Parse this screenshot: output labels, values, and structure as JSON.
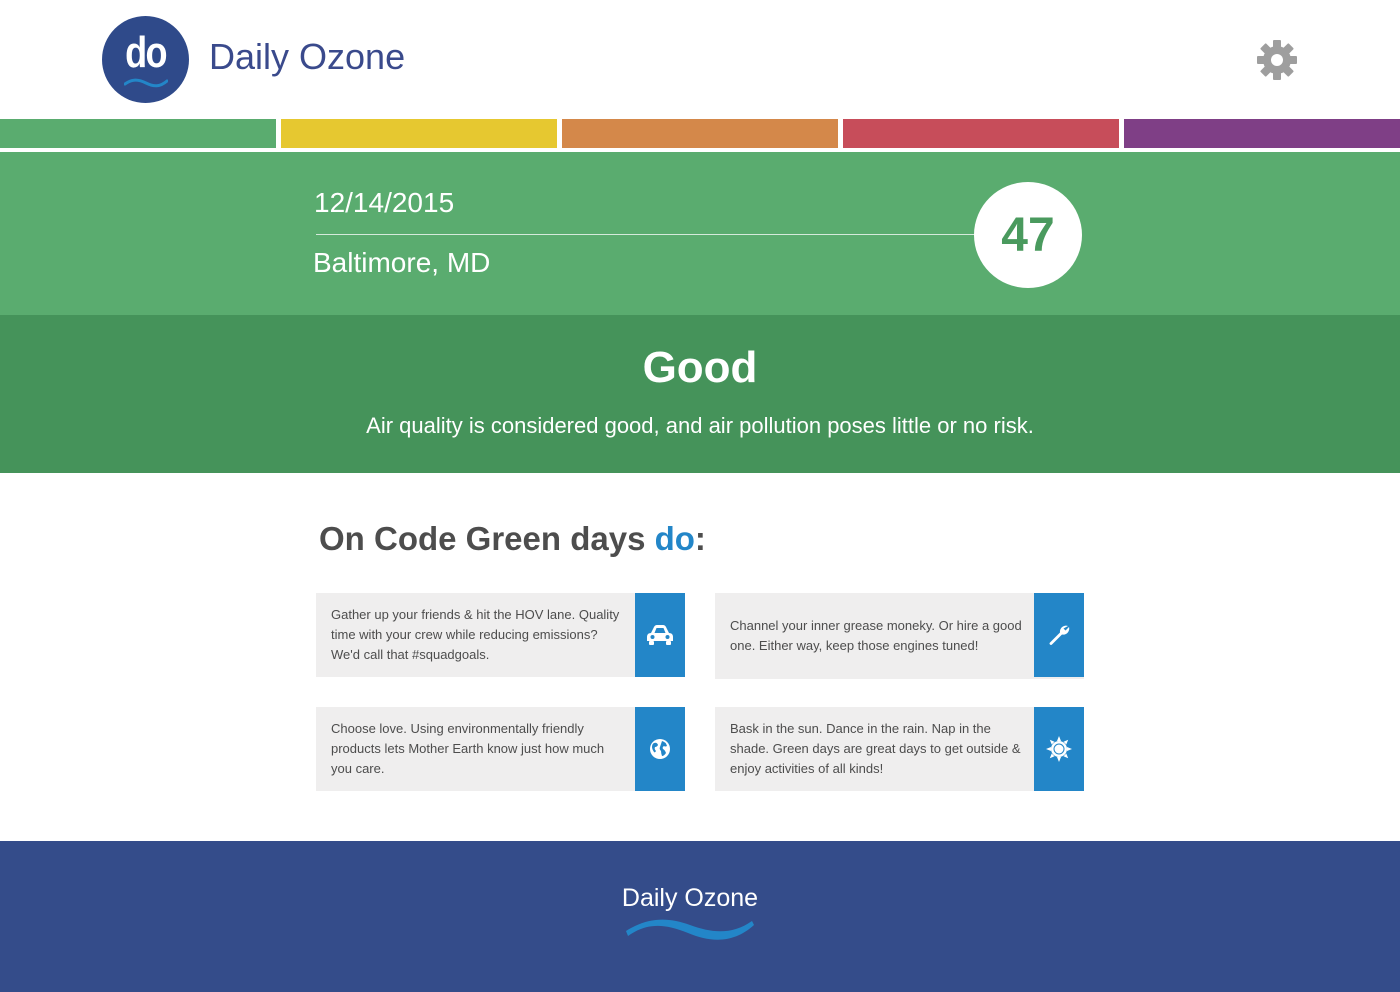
{
  "brand": {
    "logo_text": "do",
    "name": "Daily Ozone",
    "colors": {
      "primary": "#2f4a8a",
      "accent": "#2386c8"
    }
  },
  "header": {
    "settings_icon": "gear-icon"
  },
  "aqi_scale": {
    "colors": [
      "#5aac6f",
      "#e6c830",
      "#d4884a",
      "#c74d5a",
      "#7f3f86"
    ]
  },
  "forecast": {
    "date": "12/14/2015",
    "location": "Baltimore, MD",
    "aqi": "47",
    "color": "#5aac6f"
  },
  "category": {
    "title": "Good",
    "description": "Air quality is considered good, and air pollution poses little or no risk.",
    "color": "#45935a"
  },
  "tips": {
    "heading_prefix": "On Code Green days ",
    "heading_accent": "do",
    "heading_suffix": ":",
    "items": [
      {
        "text": "Gather up your friends & hit the HOV lane. Quality time with your crew while reducing emissions? We'd call that #squadgoals.",
        "icon": "car-icon"
      },
      {
        "text": "Channel your inner grease moneky. Or hire a good one. Either way, keep those engines tuned!",
        "icon": "wrench-icon"
      },
      {
        "text": "Choose love. Using environmentally friendly products lets Mother Earth know just how much you care.",
        "icon": "globe-icon"
      },
      {
        "text": "Bask in the sun. Dance in the rain. Nap in the shade. Green days are great days to get outside & enjoy activities of all kinds!",
        "icon": "sun-icon"
      }
    ]
  },
  "footer": {
    "name": "Daily Ozone"
  }
}
